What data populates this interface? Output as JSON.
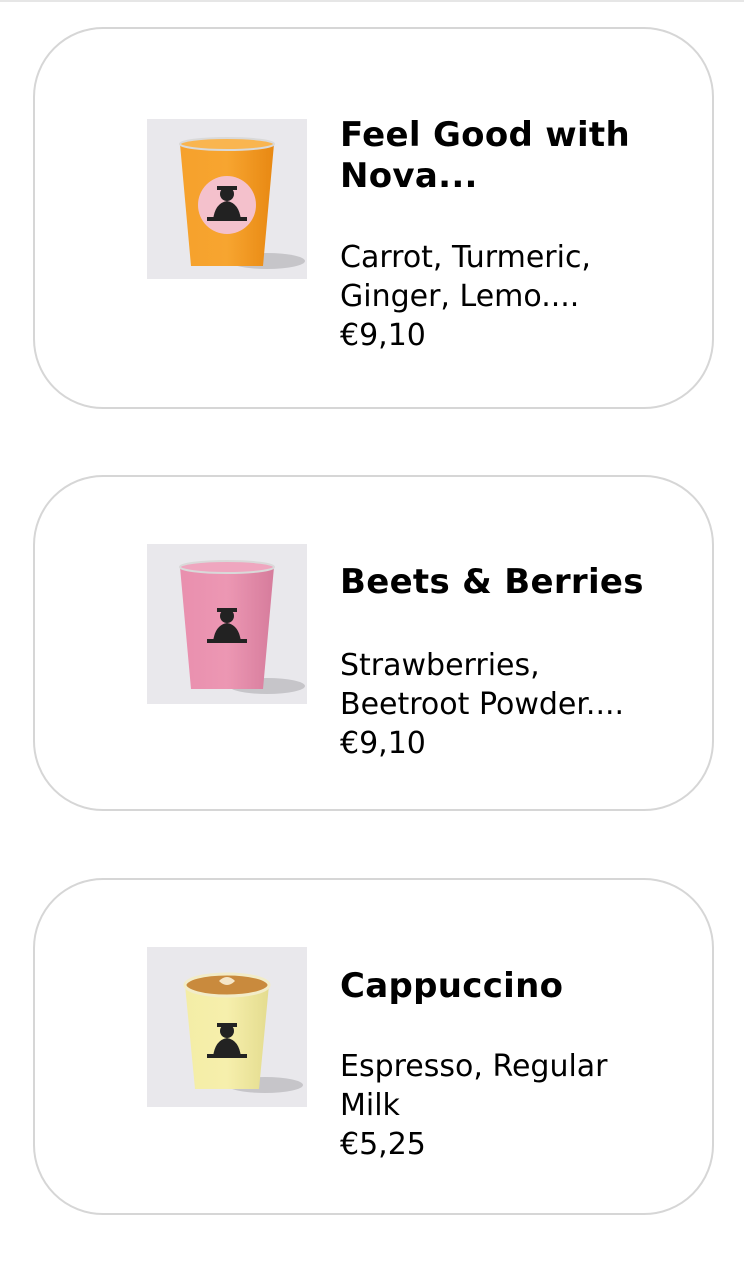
{
  "products": [
    {
      "name": "Feel Good with Nova...",
      "name_line1": "Feel Good with",
      "name_line2": "Nova...",
      "desc_line1": "Carrot, Turmeric,",
      "desc_line2": "Ginger, Lemo....",
      "price": "€9,10",
      "image_icon": "orange-juice-cup-icon",
      "cup_color": "#f39a1f"
    },
    {
      "name": "Beets & Berries",
      "desc_line1": "Strawberries,",
      "desc_line2": "Beetroot Powder....",
      "price": "€9,10",
      "image_icon": "pink-smoothie-cup-icon",
      "cup_color": "#e48aa8"
    },
    {
      "name": "Cappuccino",
      "desc_line1": "Espresso, Regular",
      "desc_line2": "Milk",
      "price": "€5,25",
      "image_icon": "coffee-cup-icon",
      "cup_color": "#f2eba0"
    }
  ]
}
